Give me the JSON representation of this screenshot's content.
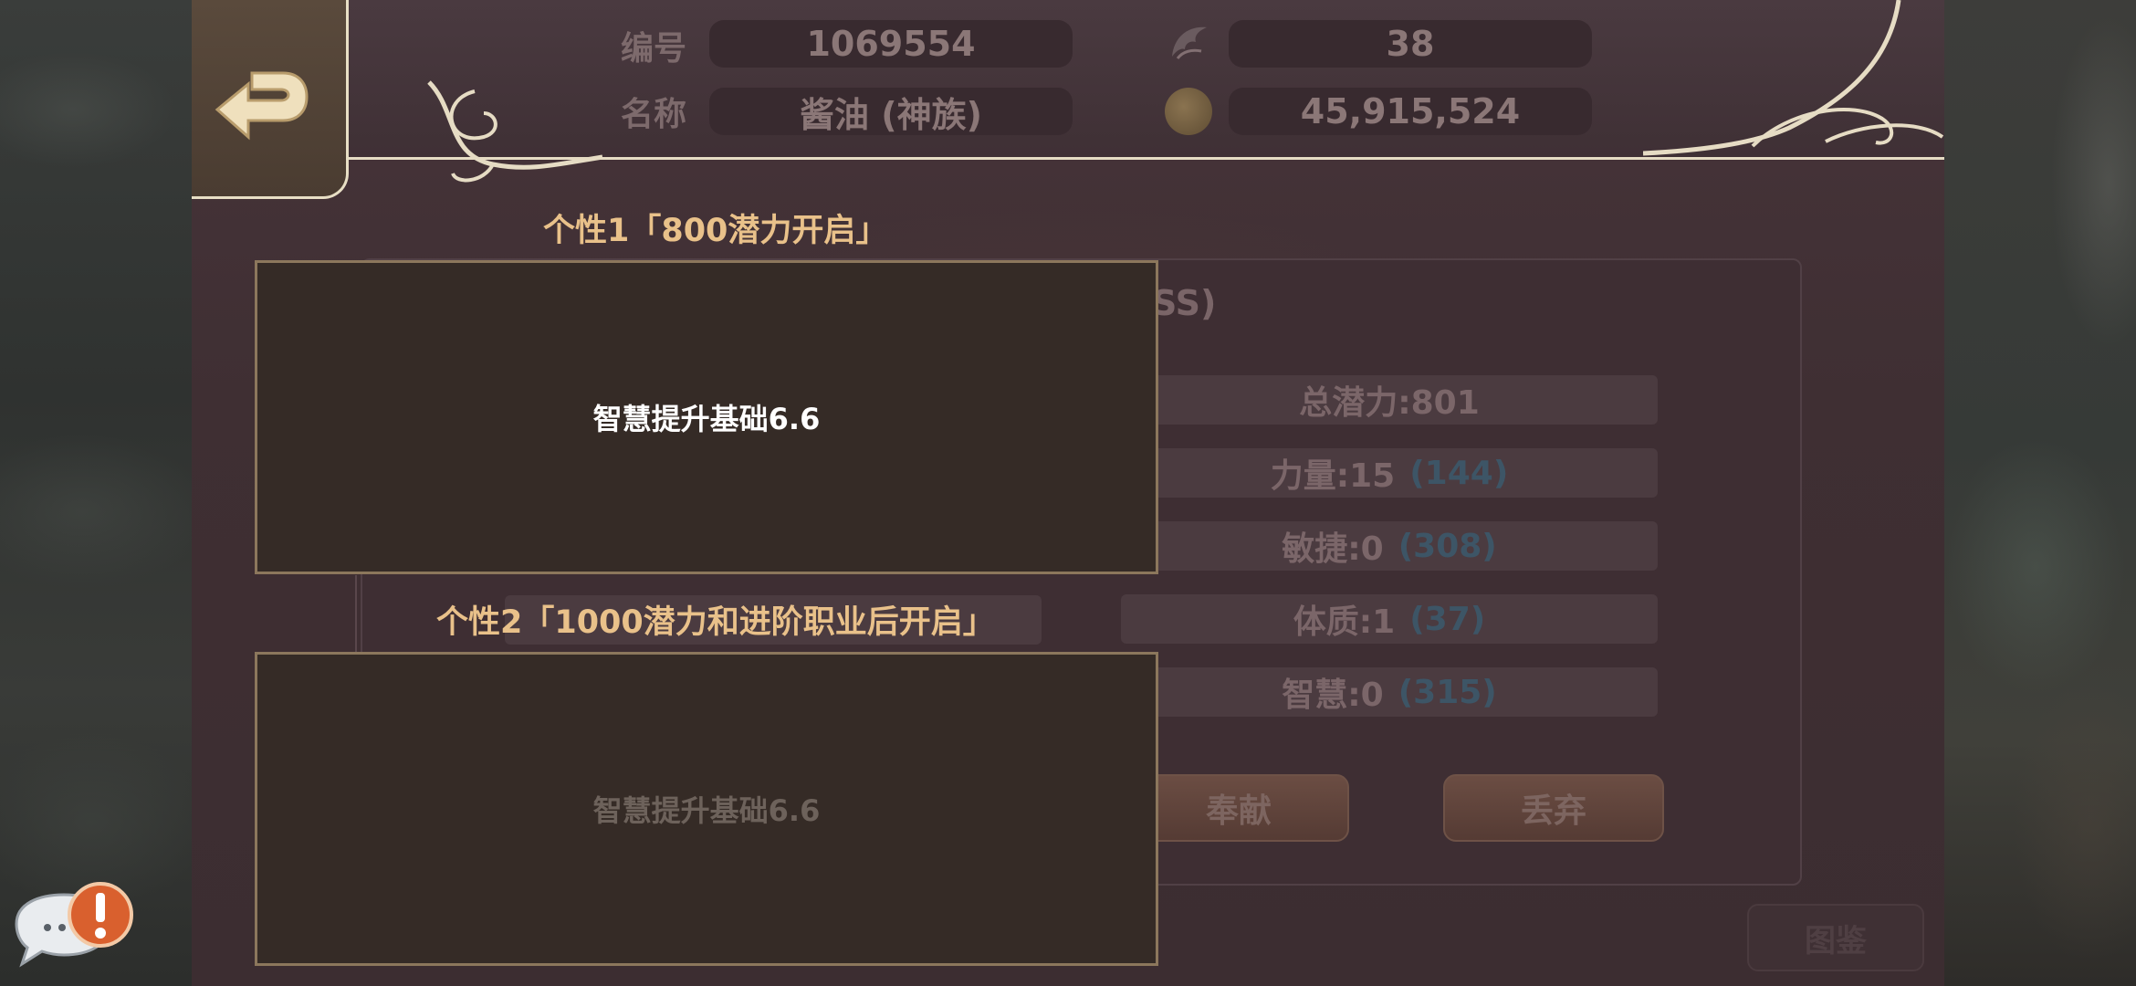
{
  "header": {
    "id_label": "编号",
    "id_value": "1069554",
    "name_label": "名称",
    "name_value": "酱油 (神族)",
    "level_icon": "wing-badge-icon",
    "level_value": "38",
    "gold_icon": "gold-coin-icon",
    "gold_value": "45,915,524"
  },
  "back_button": {
    "icon": "back-arrow-icon"
  },
  "underlying_panel": {
    "title_fragment": "SS)",
    "stats": [
      {
        "label": "总潜力:801",
        "bonus": ""
      },
      {
        "label": "力量:15",
        "bonus": "(144)"
      },
      {
        "label": "敏捷:0",
        "bonus": "(308)"
      },
      {
        "label": "体质:1",
        "bonus": "(37)"
      },
      {
        "label": "智慧:0",
        "bonus": "(315)"
      }
    ],
    "buttons": {
      "contribute": "奉献",
      "discard": "丢弃",
      "codex": "图鉴"
    }
  },
  "traits": [
    {
      "title": "个性1「800潜力开启」",
      "text": "智慧提升基础6.6",
      "unlocked": true
    },
    {
      "title": "个性2「1000潜力和进阶职业后开启」",
      "text": "智慧提升基础6.6",
      "unlocked": false
    }
  ],
  "chat": {
    "icon": "chat-bubble-icon",
    "alert_icon": "exclamation-icon"
  },
  "colors": {
    "trait_title": "#e9c18a",
    "trait_box_bg": "#352b26",
    "trait_box_border": "#8c775c",
    "panel_bg": "#3e2e33",
    "stat_bonus": "#3d5566"
  }
}
